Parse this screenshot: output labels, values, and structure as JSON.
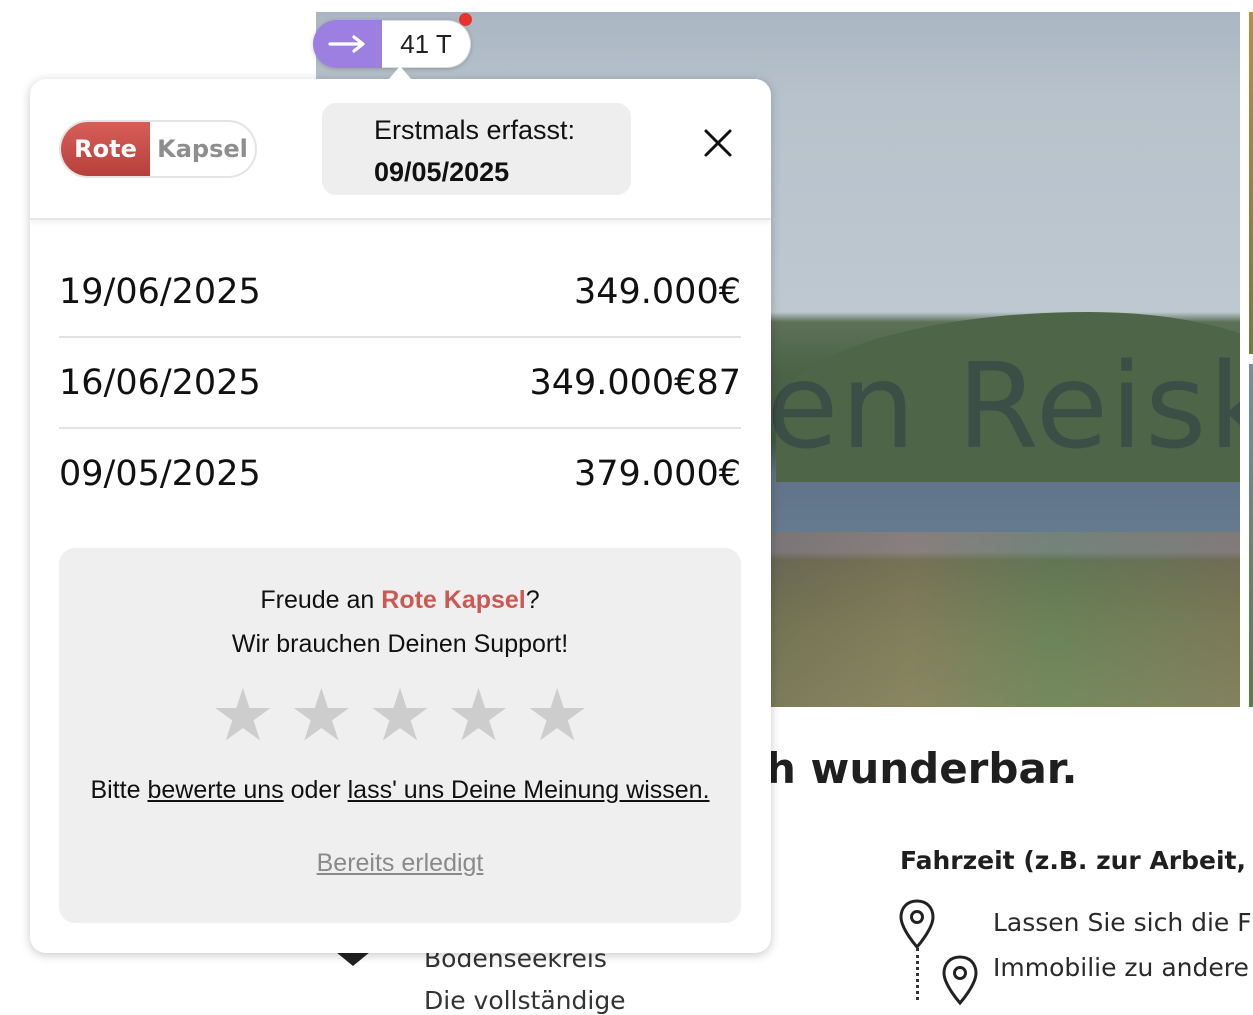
{
  "extension": {
    "days_on_market": "41 T"
  },
  "popup": {
    "brand_part1": "Rote",
    "brand_part2": "Kapsel",
    "first_seen_label": "Erstmals erfasst:",
    "first_seen_date": "09/05/2025",
    "price_history": [
      {
        "date": "19/06/2025",
        "price": "349.000€"
      },
      {
        "date": "16/06/2025",
        "price": "349.000€87"
      },
      {
        "date": "09/05/2025",
        "price": "379.000€"
      }
    ],
    "feedback": {
      "intro_prefix": "Freude an ",
      "brand_name": "Rote Kapsel",
      "intro_suffix": "?",
      "support_text": "Wir brauchen Deinen Support!",
      "rating_stars": 5,
      "links_prefix": "Bitte ",
      "rate_link": "bewerte uns",
      "links_middle": " oder ",
      "opinion_link": "lass' uns Deine Meinung wissen.",
      "done_link": "Bereits erledigt"
    }
  },
  "listing": {
    "photo_watermark": "en Reisky",
    "headline_fragment": "h wunderbar.",
    "commute_title": "Fahrzeit (z.B. zur Arbeit, Kit",
    "commute_line1": "Lassen Sie sich die F",
    "commute_line2": "Immobilie zu andere",
    "region": "Bodenseekreis",
    "region_sub": "Die vollständige"
  },
  "colors": {
    "brand_red": "#cc5853",
    "extension_purple": "#9c7fe0",
    "notification_dot": "#e8332a",
    "star_inactive": "#cdcdcd"
  }
}
